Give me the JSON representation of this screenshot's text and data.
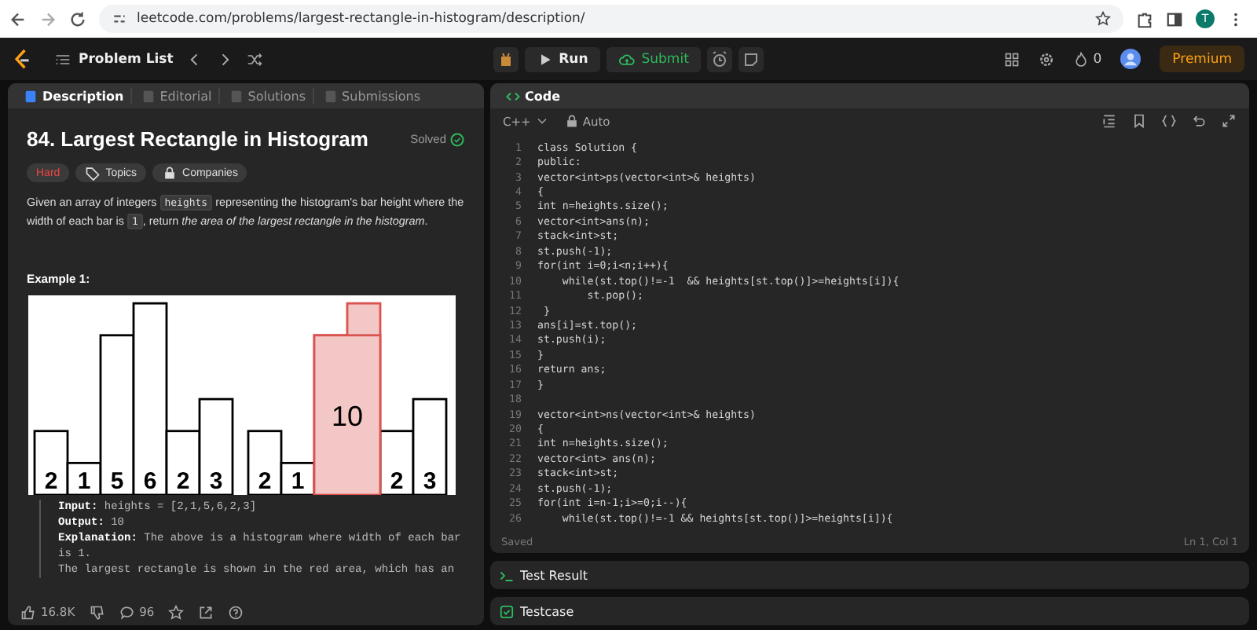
{
  "browser": {
    "url": "leetcode.com/problems/largest-rectangle-in-histogram/description/",
    "profile_initial": "T"
  },
  "navbar": {
    "problem_list": "Problem List",
    "run": "Run",
    "submit": "Submit",
    "streak": "0",
    "premium": "Premium"
  },
  "description_panel": {
    "tabs": [
      {
        "label": "Description",
        "selected": true
      },
      {
        "label": "Editorial",
        "selected": false
      },
      {
        "label": "Solutions",
        "selected": false
      },
      {
        "label": "Submissions",
        "selected": false
      }
    ],
    "title": "84. Largest Rectangle in Histogram",
    "status": "Solved",
    "tags": [
      {
        "label": "Hard",
        "kind": "difficulty"
      },
      {
        "label": "Topics",
        "kind": "topics"
      },
      {
        "label": "Companies",
        "kind": "companies"
      }
    ],
    "statement": [
      {
        "kind": "text",
        "text": "Given an array of integers "
      },
      {
        "kind": "code",
        "text": "heights"
      },
      {
        "kind": "text",
        "text": " representing the histogram's bar height where the width of each bar is "
      },
      {
        "kind": "code",
        "text": "1"
      },
      {
        "kind": "text",
        "text": ", return "
      },
      {
        "kind": "italic",
        "text": "the area of the largest rectangle in the histogram"
      },
      {
        "kind": "text",
        "text": "."
      }
    ],
    "example_title": "Example 1:",
    "figure": {
      "highlight_label": "10",
      "panels": [
        {
          "bars": [
            {
              "label": "2",
              "level": 0.32,
              "highlighted": false
            },
            {
              "label": "1",
              "level": 0.16,
              "highlighted": false
            },
            {
              "label": "5",
              "level": 0.8,
              "highlighted": false
            },
            {
              "label": "6",
              "level": 0.96,
              "highlighted": false
            },
            {
              "label": "2",
              "level": 0.32,
              "highlighted": false
            },
            {
              "label": "3",
              "level": 0.48,
              "highlighted": false
            }
          ]
        },
        {
          "bars": [
            {
              "label": "2",
              "level": 0.32,
              "highlighted": false
            },
            {
              "label": "1",
              "level": 0.16,
              "highlighted": false
            },
            {
              "level": 0.8,
              "highlighted": true
            },
            {
              "level": 0.96,
              "highlighted": true
            },
            {
              "label": "2",
              "level": 0.32,
              "highlighted": false
            },
            {
              "label": "3",
              "level": 0.48,
              "highlighted": false
            }
          ]
        }
      ]
    },
    "example_lines": [
      "**Input:** heights = [2,1,5,6,2,3]",
      "**Output:** 10",
      "**Explanation:** The above is a histogram where width of each bar is 1.",
      "The largest rectangle is shown in the red area, which has an"
    ],
    "footer": {
      "likes": "16.8K",
      "comments": "96"
    }
  },
  "code_panel": {
    "title": "Code",
    "language": "C++",
    "mode": "Auto",
    "lines": [
      {
        "number": "1",
        "text": "class Solution {"
      },
      {
        "number": "2",
        "text": "public:"
      },
      {
        "number": "3",
        "text": "vector<int>ps(vector<int>& heights)"
      },
      {
        "number": "4",
        "text": "{"
      },
      {
        "number": "5",
        "text": "int n=heights.size();"
      },
      {
        "number": "6",
        "text": "vector<int>ans(n);"
      },
      {
        "number": "7",
        "text": "stack<int>st;"
      },
      {
        "number": "8",
        "text": "st.push(-1);"
      },
      {
        "number": "9",
        "text": "for(int i=0;i<n;i++){"
      },
      {
        "number": "10",
        "text": "    while(st.top()!=-1  && heights[st.top()]>=heights[i]){"
      },
      {
        "number": "11",
        "text": "        st.pop();"
      },
      {
        "number": "12",
        "text": " }"
      },
      {
        "number": "13",
        "text": "ans[i]=st.top();"
      },
      {
        "number": "14",
        "text": "st.push(i);"
      },
      {
        "number": "15",
        "text": "}"
      },
      {
        "number": "16",
        "text": "return ans;"
      },
      {
        "number": "17",
        "text": "}"
      },
      {
        "number": "18"
      },
      {
        "number": "19",
        "text": "vector<int>ns(vector<int>& heights)"
      },
      {
        "number": "20",
        "text": "{"
      },
      {
        "number": "21",
        "text": "int n=heights.size();"
      },
      {
        "number": "22",
        "text": "vector<int> ans(n);"
      },
      {
        "number": "23",
        "text": "stack<int>st;"
      },
      {
        "number": "24",
        "text": "st.push(-1);"
      },
      {
        "number": "25",
        "text": "for(int i=n-1;i>=0;i--){"
      },
      {
        "number": "26",
        "text": "    while(st.top()!=-1 && heights[st.top()]>=heights[i]){"
      }
    ],
    "status": "Saved",
    "cursor": "Ln 1, Col 1"
  },
  "test_result": {
    "title": "Test Result"
  },
  "testcase": {
    "title": "Testcase"
  }
}
